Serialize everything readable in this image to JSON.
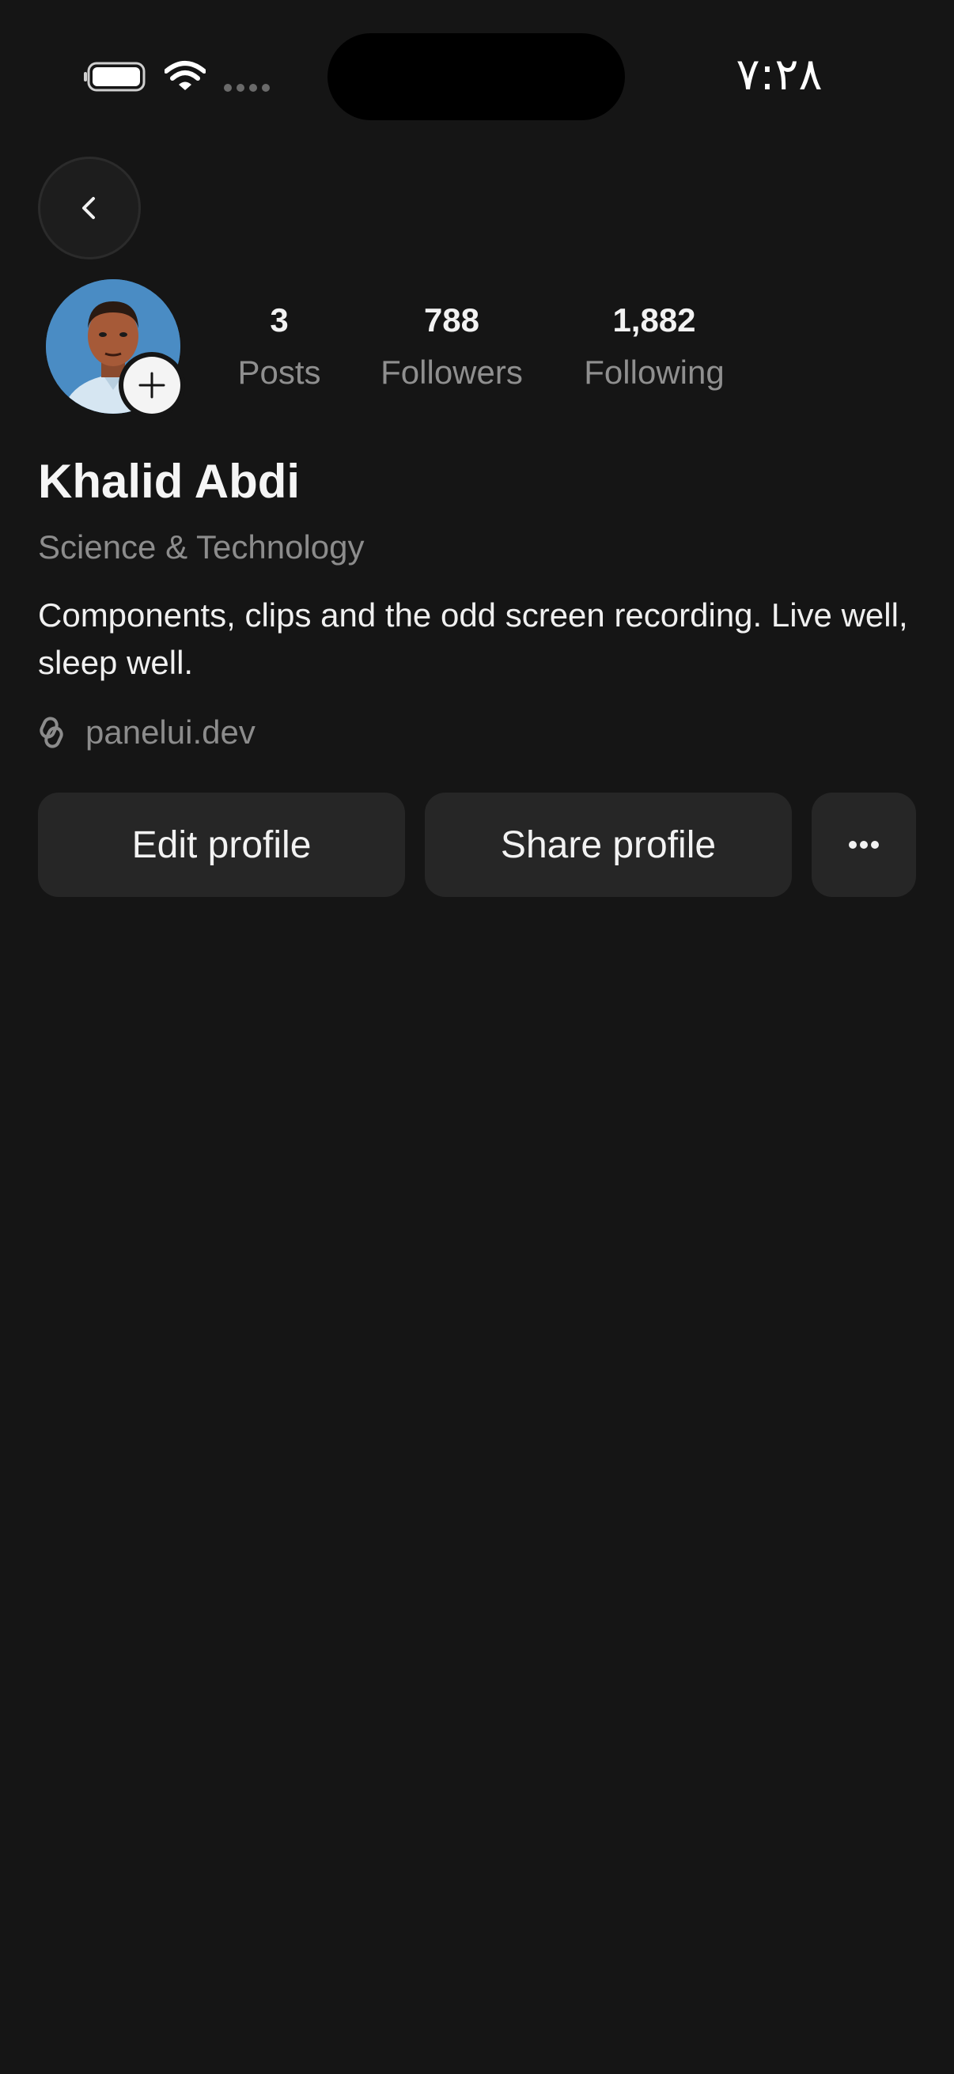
{
  "status_bar": {
    "time": "٧:٢٨"
  },
  "profile": {
    "name": "Khalid Abdi",
    "category": "Science & Technology",
    "bio": "Components, clips and the odd screen recording. Live well, sleep well.",
    "link": "panelui.dev"
  },
  "stats": {
    "posts": {
      "value": "3",
      "label": "Posts"
    },
    "followers": {
      "value": "788",
      "label": "Followers"
    },
    "following": {
      "value": "1,882",
      "label": "Following"
    }
  },
  "actions": {
    "edit_label": "Edit profile",
    "share_label": "Share profile"
  },
  "icons": {
    "back": "chevron-left-icon",
    "add_story": "plus-icon",
    "link": "link-icon",
    "more": "ellipsis-icon"
  },
  "colors": {
    "background": "#151515",
    "button": "#262626",
    "muted_text": "#8c8c8c"
  }
}
